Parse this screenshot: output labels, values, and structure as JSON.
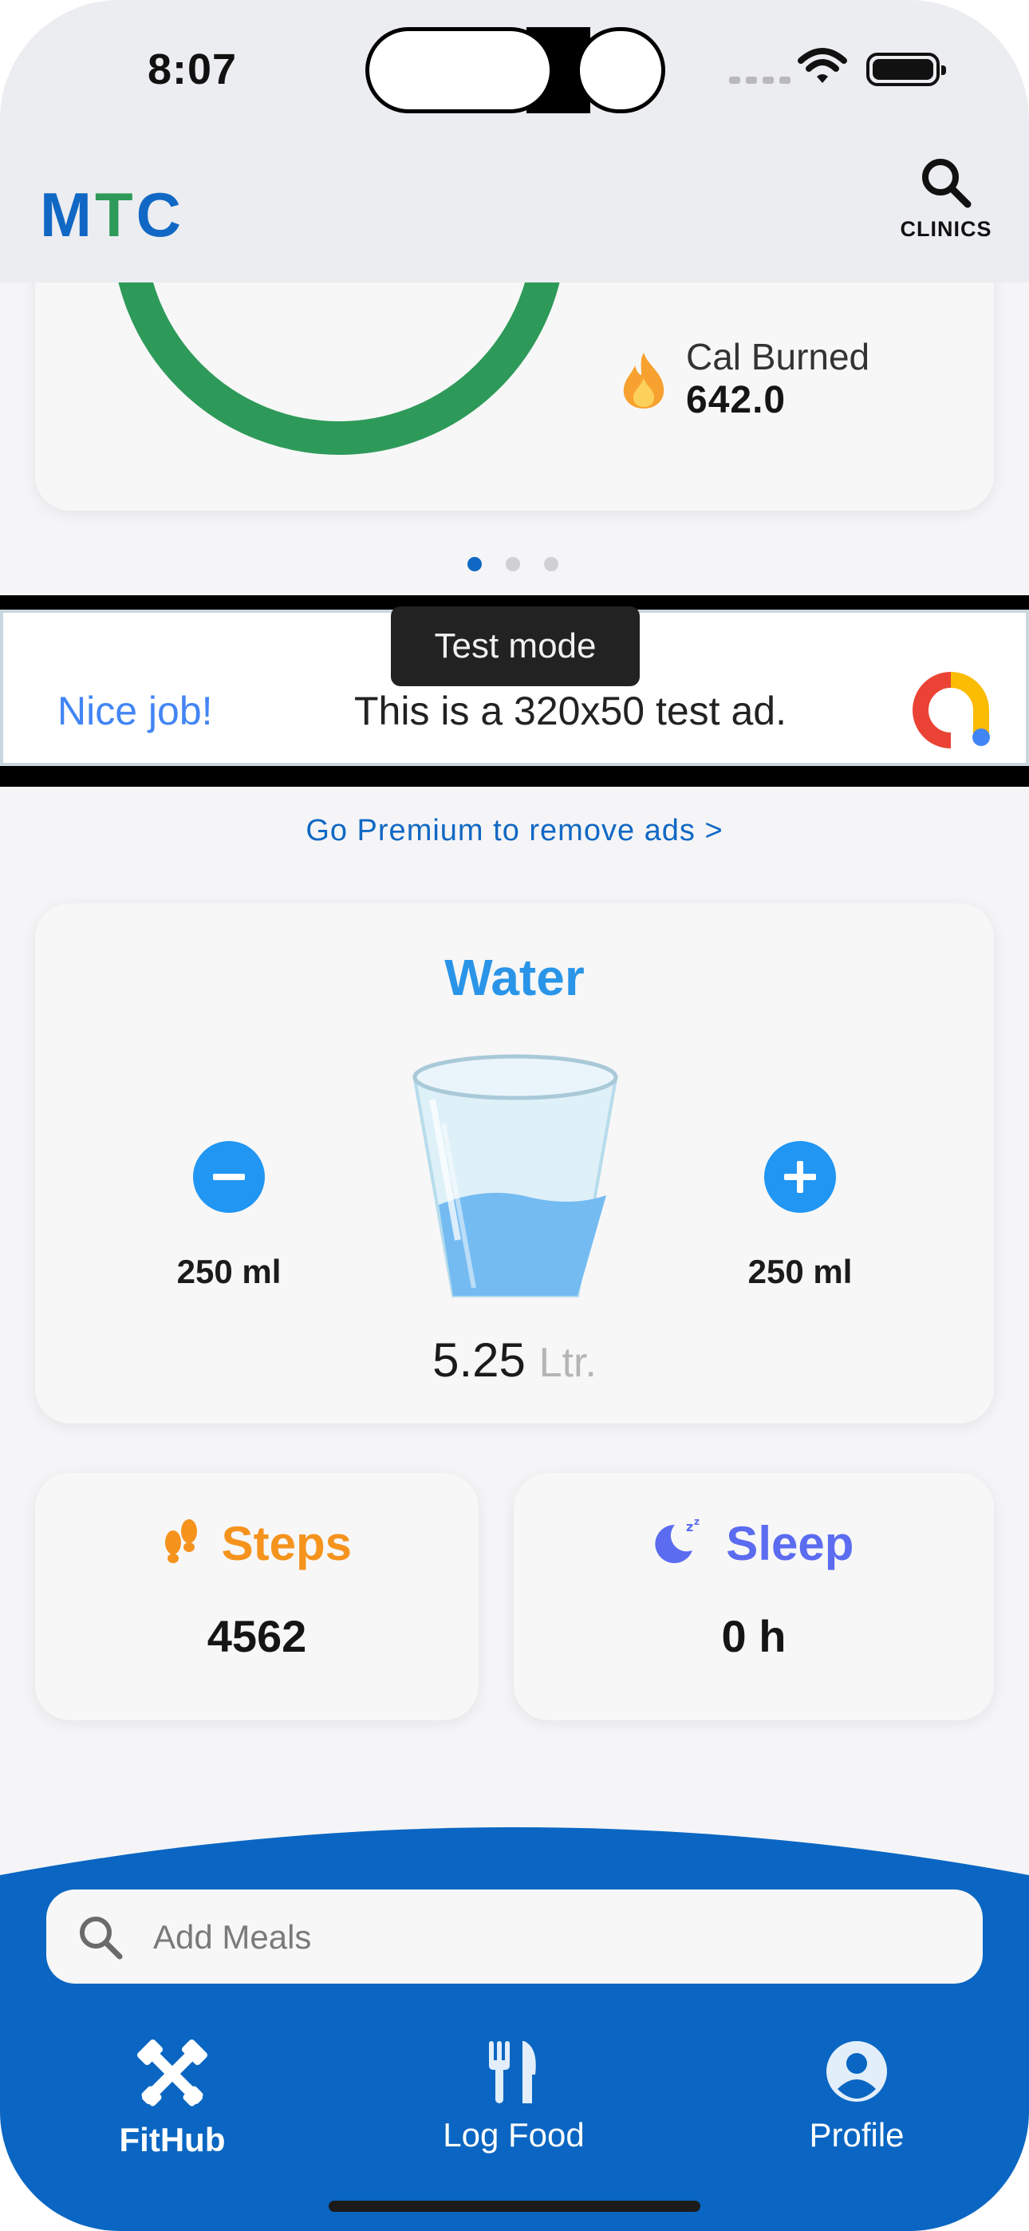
{
  "status_bar": {
    "time": "8:07"
  },
  "header": {
    "logo": {
      "m": "M",
      "t": "T",
      "c": "C"
    },
    "clinics_label": "CLINICS",
    "icons": {
      "search": "search-icon"
    }
  },
  "activity": {
    "cal_burned_label": "Cal Burned",
    "cal_burned_value": "642.0",
    "ring_color": "#2e9a59",
    "pager": {
      "pages": 3,
      "active": 1
    }
  },
  "ad": {
    "badge": "Test mode",
    "headline": "Nice job!",
    "text": "This is a 320x50 test ad."
  },
  "premium_link": "Go Premium to remove ads >",
  "water": {
    "title": "Water",
    "decrement_label": "250 ml",
    "increment_label": "250 ml",
    "total_value": "5.25",
    "total_unit": "Ltr."
  },
  "steps": {
    "title": "Steps",
    "value": "4562"
  },
  "sleep": {
    "title": "Sleep",
    "value": "0 h"
  },
  "search": {
    "placeholder": "Add Meals"
  },
  "tabs": [
    {
      "label": "FitHub",
      "icon": "tools-icon",
      "active": true
    },
    {
      "label": "Log Food",
      "icon": "utensils-icon",
      "active": false
    },
    {
      "label": "Profile",
      "icon": "account-icon",
      "active": false
    }
  ],
  "colors": {
    "brand_blue": "#1168c4",
    "brand_green": "#2e9a59",
    "water_blue": "#2196f3",
    "steps_orange": "#f5931d",
    "sleep_indigo": "#5b6cf0",
    "nav_blue": "#0a66c2"
  }
}
